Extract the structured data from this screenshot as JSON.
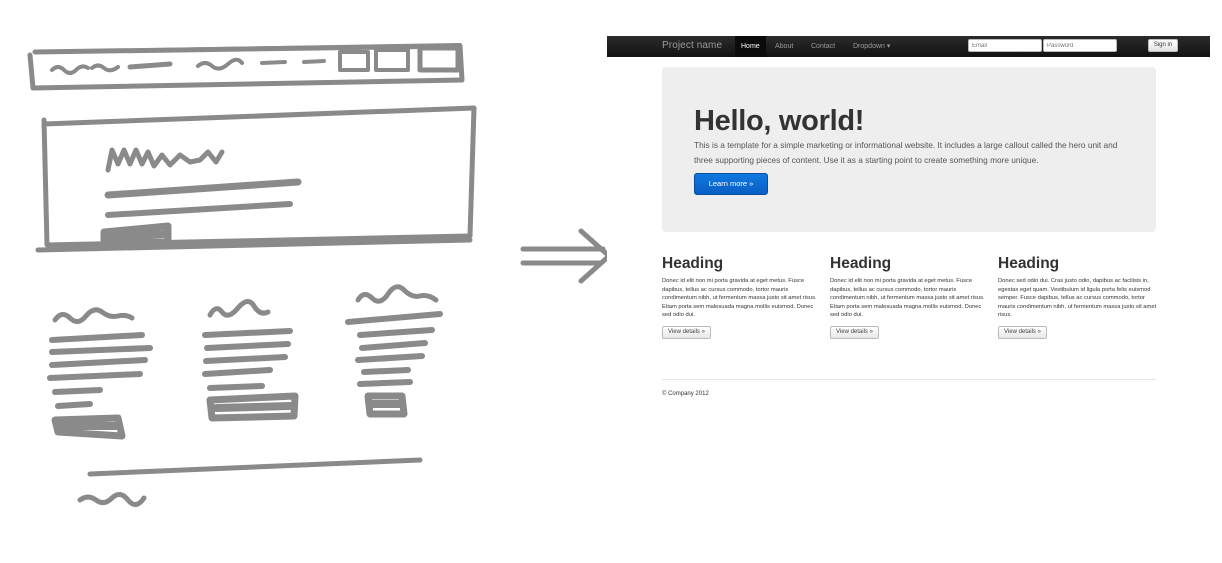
{
  "sketch": {},
  "mockup": {
    "navbar": {
      "brand": "Project name",
      "links": [
        "Home",
        "About",
        "Contact",
        "Dropdown ▾"
      ],
      "active_index": 0,
      "email_placeholder": "Email",
      "password_placeholder": "Password",
      "signin_label": "Sign in"
    },
    "hero": {
      "title": "Hello, world!",
      "text": "This is a template for a simple marketing or informational website. It includes a large callout called the hero unit and three supporting pieces of content. Use it as a starting point to create something more unique.",
      "button_label": "Learn more »"
    },
    "columns": [
      {
        "heading": "Heading",
        "text": "Donec id elit non mi porta gravida at eget metus. Fusce dapibus, tellus ac cursus commodo, tortor mauris condimentum nibh, ut fermentum massa justo sit amet risus. Etiam porta sem malesuada magna mollis euismod. Donec sed odio dui.",
        "button_label": "View details »"
      },
      {
        "heading": "Heading",
        "text": "Donec id elit non mi porta gravida at eget metus. Fusce dapibus, tellus ac cursus commodo, tortor mauris condimentum nibh, ut fermentum massa justo sit amet risus. Etiam porta sem malesuada magna mollis euismod. Donec sed odio dui.",
        "button_label": "View details »"
      },
      {
        "heading": "Heading",
        "text": "Donec sed odio dui. Cras justo odio, dapibus ac facilisis in, egestas eget quam. Vestibulum id ligula porta felis euismod semper. Fusce dapibus, tellus ac cursus commodo, tortor mauris condimentum nibh, ut fermentum massa justo sit amet risus.",
        "button_label": "View details »"
      }
    ],
    "footer": "© Company 2012"
  },
  "colors": {
    "sketch_stroke": "#8a8a8a",
    "navbar": "#1b1b1b",
    "hero_bg": "#eeeeee",
    "primary_button": "#0a6fd8"
  }
}
